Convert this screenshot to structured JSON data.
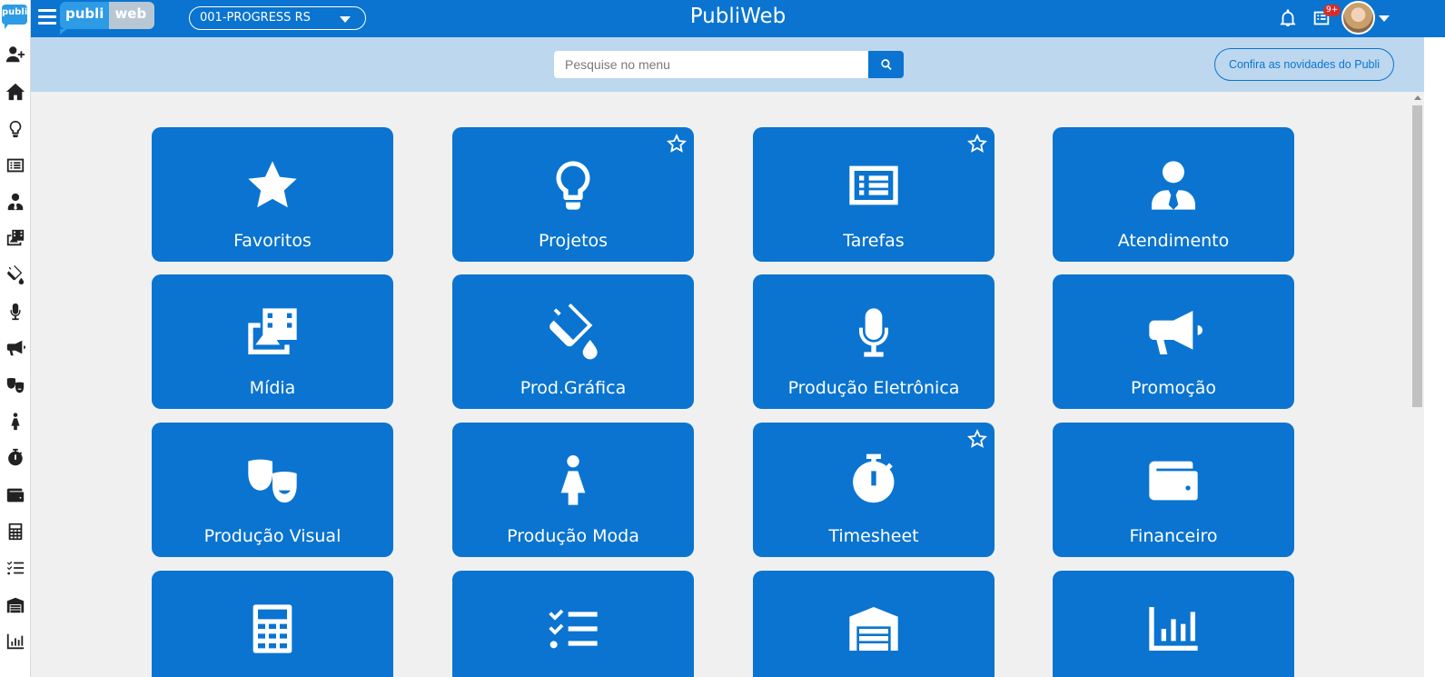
{
  "app": {
    "title": "PubliWeb",
    "brand_left": "publi",
    "brand_right": "web",
    "rail_logo": "publi"
  },
  "company_selector": {
    "value": "001-PROGRESS RS"
  },
  "topbar": {
    "notifications_badge": "9+",
    "icons": [
      "bell-icon",
      "news-list-icon",
      "help-icon",
      "avatar"
    ]
  },
  "search": {
    "placeholder": "Pesquise no menu"
  },
  "news_button": {
    "label": "Confira as novidades do Publi"
  },
  "rail": [
    "add-user-icon",
    "home-icon",
    "lightbulb-icon",
    "list-icon",
    "user-tie-icon",
    "photo-film-icon",
    "paint-bucket-icon",
    "microphone-icon",
    "megaphone-icon",
    "masks-icon",
    "person-dress-icon",
    "stopwatch-icon",
    "wallet-icon",
    "calculator-icon",
    "list-check-icon",
    "warehouse-icon",
    "chart-icon"
  ],
  "tiles": [
    {
      "label": "Favoritos",
      "icon": "star-icon",
      "favorite": false
    },
    {
      "label": "Projetos",
      "icon": "lightbulb-icon",
      "favorite": true
    },
    {
      "label": "Tarefas",
      "icon": "list-icon",
      "favorite": true
    },
    {
      "label": "Atendimento",
      "icon": "user-tie-icon",
      "favorite": false
    },
    {
      "label": "Mídia",
      "icon": "photo-film-icon",
      "favorite": false
    },
    {
      "label": "Prod.Gráfica",
      "icon": "paint-bucket-icon",
      "favorite": false
    },
    {
      "label": "Produção Eletrônica",
      "icon": "microphone-icon",
      "favorite": false
    },
    {
      "label": "Promoção",
      "icon": "megaphone-icon",
      "favorite": false
    },
    {
      "label": "Produção Visual",
      "icon": "masks-icon",
      "favorite": false
    },
    {
      "label": "Produção Moda",
      "icon": "person-dress-icon",
      "favorite": false
    },
    {
      "label": "Timesheet",
      "icon": "stopwatch-icon",
      "favorite": true
    },
    {
      "label": "Financeiro",
      "icon": "wallet-icon",
      "favorite": false
    },
    {
      "label": "",
      "icon": "calculator-icon",
      "favorite": false
    },
    {
      "label": "",
      "icon": "list-check-icon",
      "favorite": false
    },
    {
      "label": "",
      "icon": "warehouse-icon",
      "favorite": false
    },
    {
      "label": "",
      "icon": "chart-icon",
      "favorite": false
    }
  ],
  "colors": {
    "primary": "#0a74d0",
    "strip": "#bdd7ee",
    "background": "#f0f0f0",
    "badge": "#d32f2f"
  }
}
